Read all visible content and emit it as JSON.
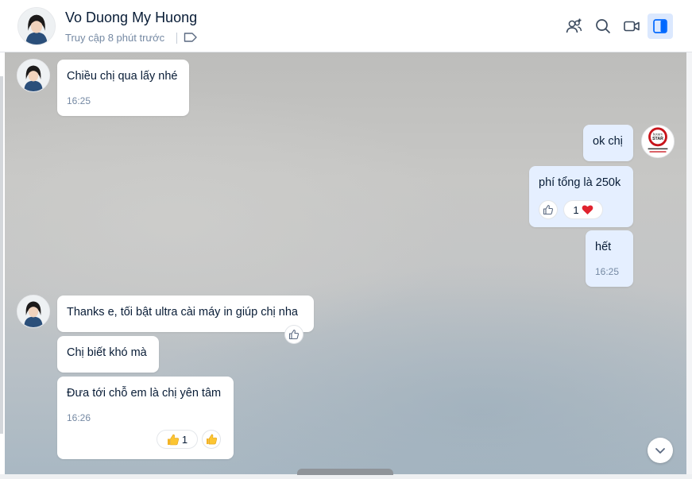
{
  "header": {
    "name": "Vo Duong My Huong",
    "status": "Truy cập 8 phút trước",
    "icons": [
      "add-member-icon",
      "search-icon",
      "video-call-icon",
      "panel-toggle-icon"
    ]
  },
  "messages": [
    {
      "text": "Chiều chị qua lấy nhé",
      "time": "16:25"
    },
    {
      "text": "ok chị"
    },
    {
      "text": "phí tổng là 250k",
      "reaction_count": "1"
    },
    {
      "text": "hết",
      "time": "16:25"
    },
    {
      "text": "Thanks e, tối bật ultra cài máy in giúp chị nha"
    },
    {
      "text": "Chị biết khó mà"
    },
    {
      "text": "Đưa tới chỗ em là chị yên tâm",
      "time": "16:26",
      "reaction_count": "1"
    }
  ],
  "sender_logo": {
    "top_text": "luxury",
    "bottom_text": "STAR"
  },
  "colors": {
    "outgoing_bubble": "#e5efff",
    "incoming_bubble": "#ffffff",
    "accent": "#0068ff"
  }
}
